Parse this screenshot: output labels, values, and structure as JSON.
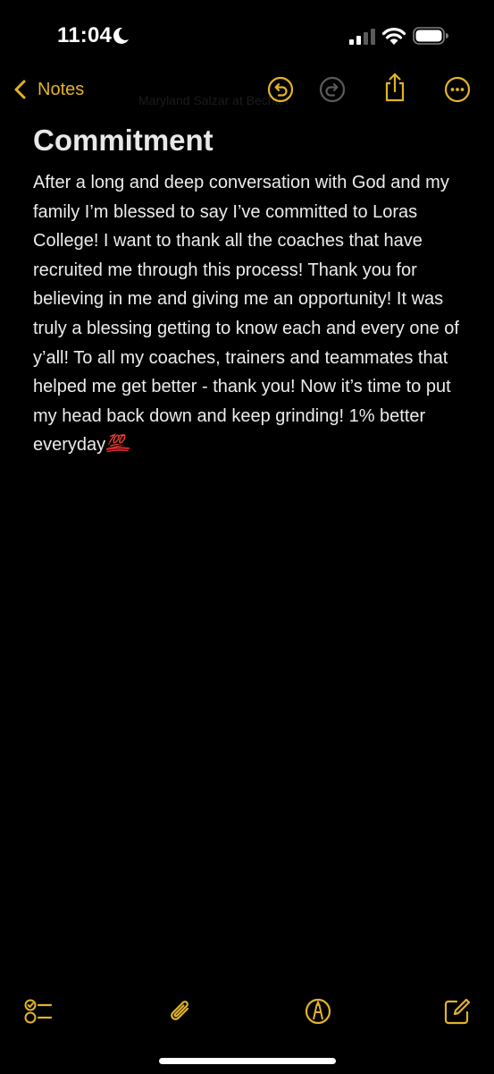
{
  "status_bar": {
    "time": "11:04",
    "moon_icon": "moon-icon",
    "signal_icon": "cellular-signal-icon",
    "wifi_icon": "wifi-icon",
    "battery_icon": "battery-icon"
  },
  "nav": {
    "back_label": "Notes",
    "faint_title": "Maryland Salzar at Bechtel",
    "icons": [
      "chevron-left-icon",
      "undo-icon",
      "redo-icon",
      "share-icon",
      "more-icon"
    ]
  },
  "note": {
    "title": "Commitment",
    "body": "After a long and deep conversation with God and my family I’m blessed to say I’ve committed to Loras College! I want to thank all the coaches that have recruited me through this process! Thank you for believing in me and giving me an opportunity! It was truly a blessing getting to know each and every one of y’all! To all my coaches, trainers and teammates that helped me get better - thank you! Now it’s time to put my head back down and keep grinding! 1% better everyday",
    "trailing_emoji": "💯"
  },
  "toolbar": {
    "icons": [
      "checklist-icon",
      "paperclip-icon",
      "markup-pen-icon",
      "compose-icon"
    ]
  },
  "colors": {
    "accent": "#e2b229",
    "background": "#000000",
    "text": "#ececec",
    "disabled_icon": "#5a5a5a",
    "emoji_red": "#d7262e"
  }
}
